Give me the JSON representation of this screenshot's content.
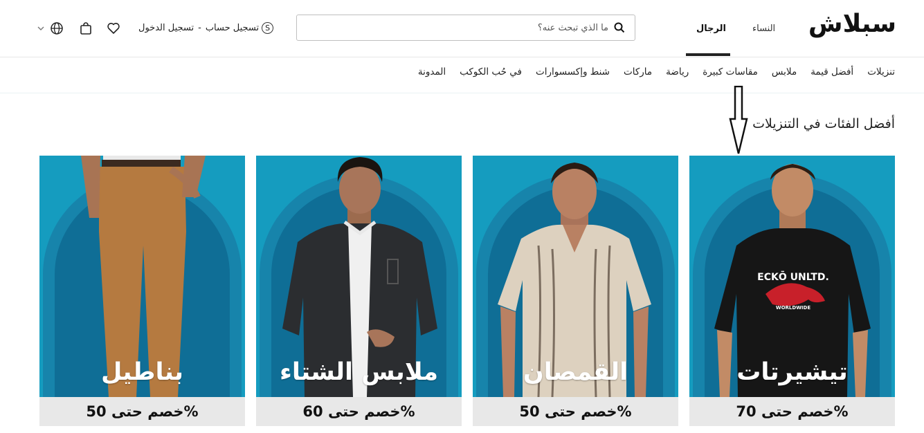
{
  "header": {
    "logo": "سبلاش",
    "gender_tabs": [
      {
        "label": "النساء",
        "active": false
      },
      {
        "label": "الرجال",
        "active": true
      }
    ],
    "search_placeholder": "ما الذي تبحث عنه؟",
    "account": {
      "register": "تسجيل حساب",
      "separator": "-",
      "login": "تسجيل الدخول"
    },
    "icons": [
      "coin-icon",
      "globe-icon",
      "chevron-down-icon",
      "bag-icon",
      "heart-icon",
      "search-icon"
    ]
  },
  "nav": {
    "items": [
      "تنزيلات",
      "أفضل قيمة",
      "ملابس",
      "مقاسات كبيرة",
      "رياضة",
      "ماركات",
      "شنط وإكسسوارات",
      "في حُب الكوكب",
      "المدونة"
    ]
  },
  "section": {
    "title": "أفضل الفئات في التنزيلات"
  },
  "cards": [
    {
      "label": "تيشيرتات",
      "discount": "خصم حتى 70%",
      "shirt_print": "ECKŌ UNLTD.",
      "shirt_sub": "WORLDWIDE"
    },
    {
      "label": "القمصان",
      "discount": "خصم حتى 50%"
    },
    {
      "label": "ملابس الشتاء",
      "discount": "خصم حتى 60%"
    },
    {
      "label": "بناطيل",
      "discount": "خصم حتى 50%"
    }
  ],
  "colors": {
    "card_bg": "#159cbf",
    "accent": "#222222",
    "discount_bg": "#e8e8e8"
  }
}
